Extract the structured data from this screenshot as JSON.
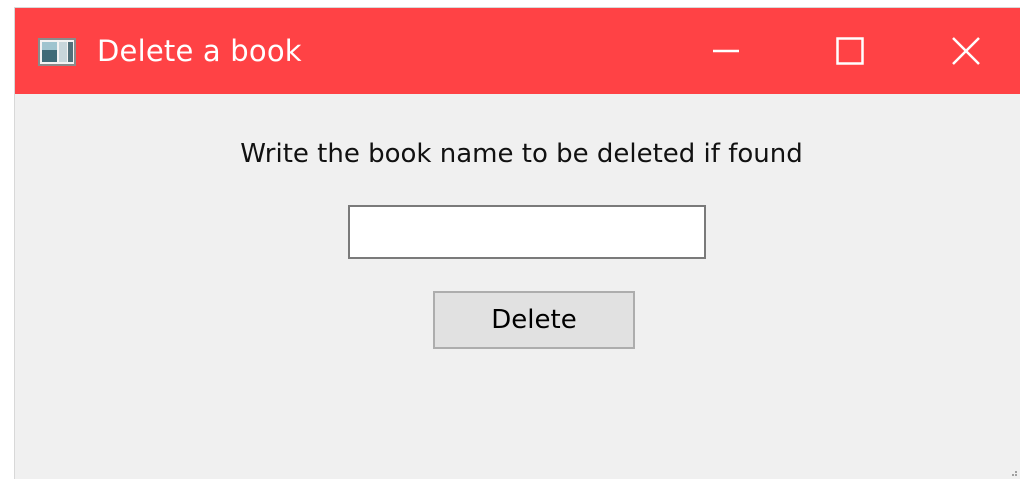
{
  "window": {
    "title": "Delete a book",
    "titlebar_color": "#ff4245",
    "background_color": "#f0f0f0",
    "controls": {
      "minimize_icon": "minimize-icon",
      "maximize_icon": "maximize-icon",
      "close_icon": "close-icon"
    }
  },
  "form": {
    "prompt": "Write the book name to be deleted if found",
    "book_name_value": "",
    "delete_label": "Delete"
  }
}
